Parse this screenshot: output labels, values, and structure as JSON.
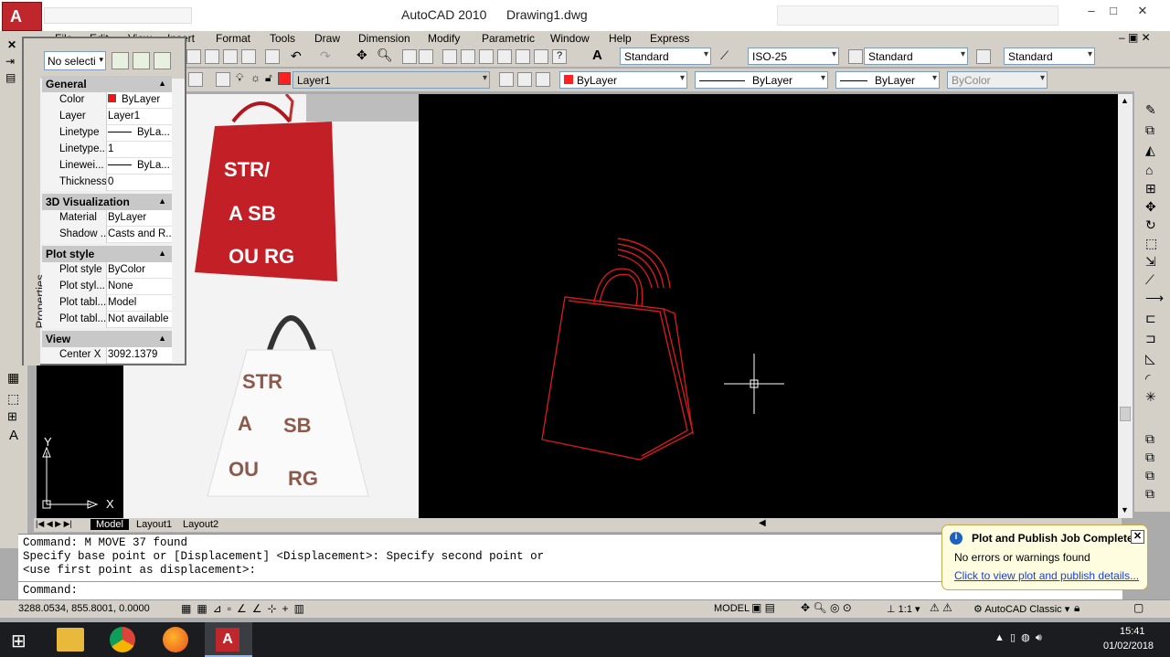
{
  "title": {
    "app": "AutoCAD 2010",
    "document": "Drawing1.dwg"
  },
  "window_controls": {
    "minimize": "‒",
    "maximize": "□",
    "close": "✕"
  },
  "menu": [
    "File",
    "Edit",
    "View",
    "Insert",
    "Format",
    "Tools",
    "Draw",
    "Dimension",
    "Modify",
    "Parametric",
    "Window",
    "Help",
    "Express"
  ],
  "styles_toolbar": {
    "text_style": "Standard",
    "dim_style": "ISO-25",
    "table_style": "Standard",
    "mleader_style": "Standard"
  },
  "layers_toolbar": {
    "current_layer": "Layer1",
    "color": "ByLayer",
    "linetype": "ByLayer",
    "lineweight": "ByLayer",
    "plot_style": "ByColor"
  },
  "properties": {
    "panel_label": "Properties",
    "selection": "No selecti",
    "sections": {
      "general": {
        "title": "General",
        "rows": [
          {
            "key": "Color",
            "value": "ByLayer"
          },
          {
            "key": "Layer",
            "value": "Layer1"
          },
          {
            "key": "Linetype",
            "value": "ByLa..."
          },
          {
            "key": "Linetype...",
            "value": "1"
          },
          {
            "key": "Linewei...",
            "value": "ByLa..."
          },
          {
            "key": "Thickness",
            "value": "0"
          }
        ]
      },
      "viz": {
        "title": "3D Visualization",
        "rows": [
          {
            "key": "Material",
            "value": "ByLayer"
          },
          {
            "key": "Shadow ...",
            "value": "Casts and R..."
          }
        ]
      },
      "plot": {
        "title": "Plot style",
        "rows": [
          {
            "key": "Plot style",
            "value": "ByColor"
          },
          {
            "key": "Plot styl...",
            "value": "None"
          },
          {
            "key": "Plot tabl...",
            "value": "Model"
          },
          {
            "key": "Plot tabl...",
            "value": "Not available"
          }
        ]
      },
      "view": {
        "title": "View",
        "rows": [
          {
            "key": "Center X",
            "value": "3092.1379"
          }
        ]
      }
    }
  },
  "ucs": {
    "x": "X",
    "y": "Y"
  },
  "layout_tabs": [
    "Model",
    "Layout1",
    "Layout2"
  ],
  "command": {
    "lines": [
      "Command: M MOVE 37 found",
      "Specify base point or [Displacement] <Displacement>: Specify second point or",
      "<use first point as displacement>:"
    ],
    "prompt": "Command:"
  },
  "status": {
    "coords": "3288.0534, 855.8001, 0.0000",
    "model": "MODEL",
    "scale": "1:1",
    "workspace": "AutoCAD Classic"
  },
  "notification": {
    "title": "Plot and Publish Job Complete",
    "message": "No errors or warnings found",
    "link": "Click to view plot and publish details..."
  },
  "clock": {
    "time": "15:41",
    "date": "01/02/2018"
  },
  "bag_text": {
    "r1": "STR/",
    "r2": "A SB",
    "r3": "OU RG",
    "line1": "STR",
    "line2": "A",
    "line3": "SB",
    "line4": "OU",
    "line5": "RG"
  },
  "colors": {
    "accent": "#c0272d",
    "canvas": "#000000",
    "entity": "#d11a1a"
  }
}
